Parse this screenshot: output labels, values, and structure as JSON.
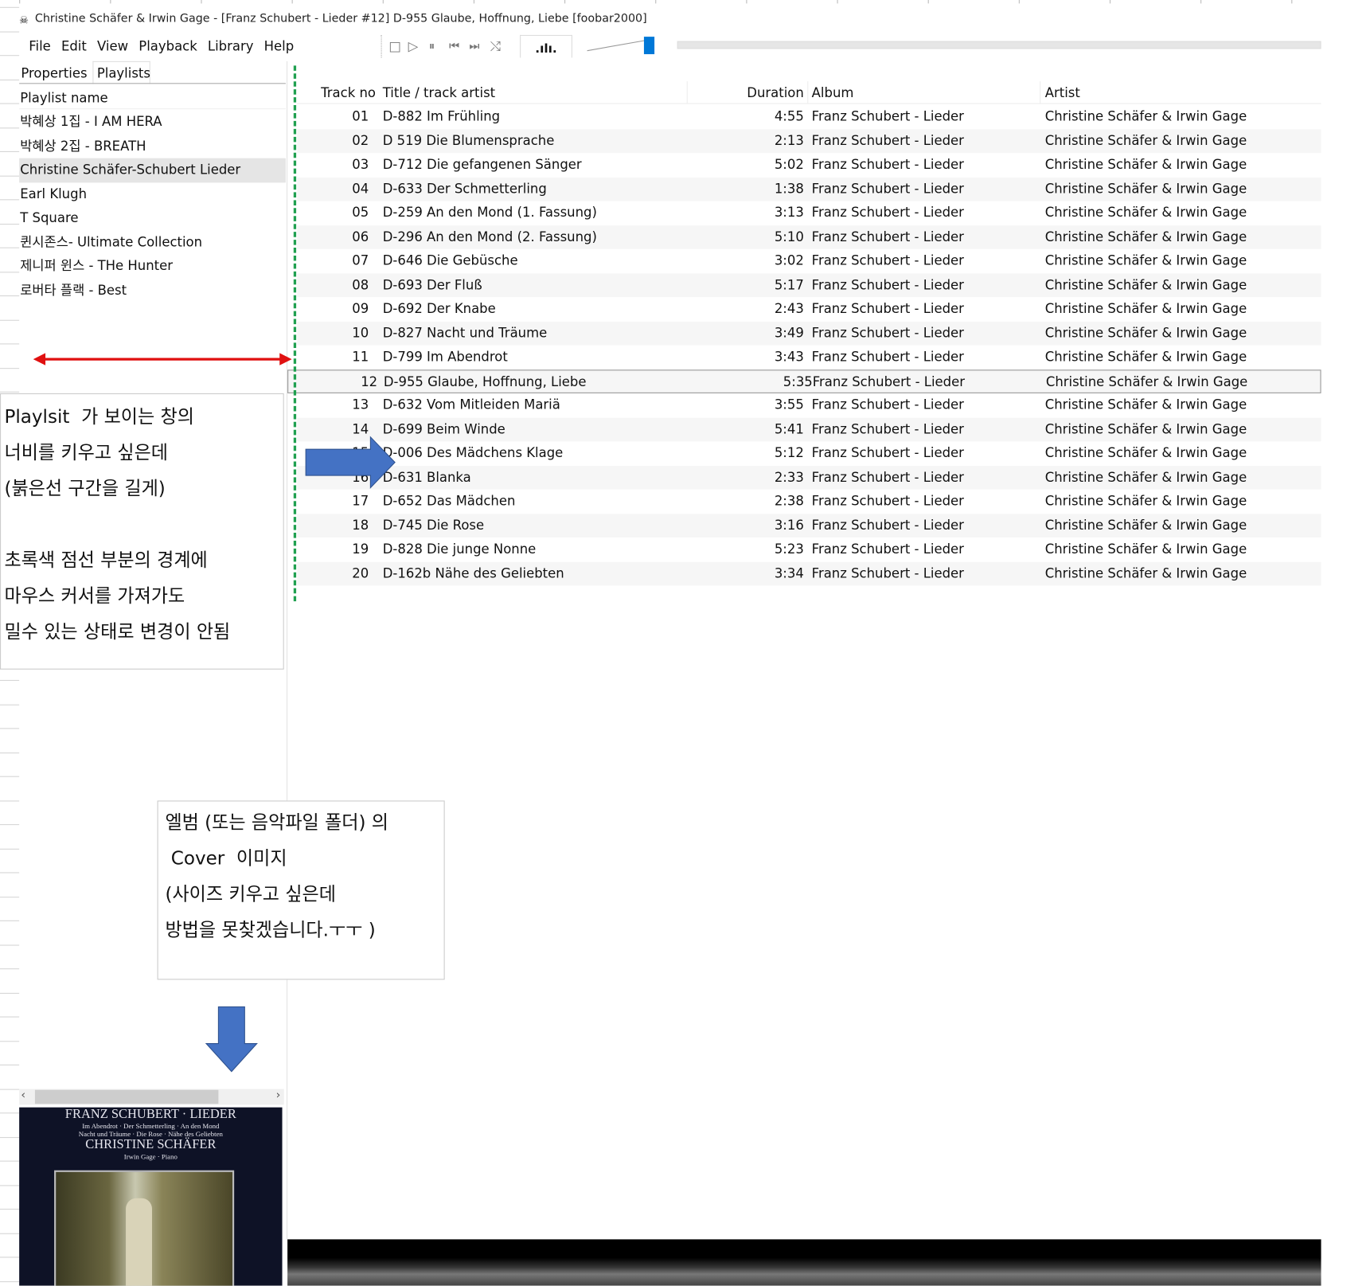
{
  "window": {
    "title": "Christine Schäfer & Irwin Gage - [Franz Schubert - Lieder #12] D-955 Glaube, Hoffnung, Liebe  [foobar2000]"
  },
  "menu": [
    "File",
    "Edit",
    "View",
    "Playback",
    "Library",
    "Help"
  ],
  "toolbar": {
    "stop": "□",
    "play": "▷",
    "pause": "⏸",
    "prev": "⏮",
    "next": "⏭",
    "random": "⤭",
    "visualizer": ".ılı.",
    "volume_percent": 95,
    "seek_percent": 0
  },
  "left_panel": {
    "tabs": [
      "Properties",
      "Playlists"
    ],
    "active_tab": "Playlists",
    "header": "Playlist name",
    "playlists": [
      "박혜상 1집 -  I AM HERA",
      "박혜상 2집 -  BREATH",
      "Christine Schäfer-Schubert Lieder",
      "Earl Klugh",
      "T Square",
      "퀸시존스-  Ultimate Collection",
      "제니퍼 윈스 -  THe Hunter",
      "로버타 플랙 - Best"
    ],
    "selected_index": 2
  },
  "columns": {
    "track": "Track no",
    "title": "Title / track artist",
    "duration": "Duration",
    "album": "Album",
    "artist": "Artist"
  },
  "tracks": [
    {
      "no": "01",
      "title": "D-882 Im Frühling",
      "dur": "4:55"
    },
    {
      "no": "02",
      "title": "D 519 Die Blumensprache",
      "dur": "2:13"
    },
    {
      "no": "03",
      "title": "D-712 Die gefangenen Sänger",
      "dur": "5:02"
    },
    {
      "no": "04",
      "title": "D-633 Der Schmetterling",
      "dur": "1:38"
    },
    {
      "no": "05",
      "title": "D-259 An den Mond (1. Fassung)",
      "dur": "3:13"
    },
    {
      "no": "06",
      "title": "D-296 An den Mond (2. Fassung)",
      "dur": "5:10"
    },
    {
      "no": "07",
      "title": "D-646 Die Gebüsche",
      "dur": "3:02"
    },
    {
      "no": "08",
      "title": "D-693 Der Fluß",
      "dur": "5:17"
    },
    {
      "no": "09",
      "title": "D-692 Der Knabe",
      "dur": "2:43"
    },
    {
      "no": "10",
      "title": "D-827 Nacht und Träume",
      "dur": "3:49"
    },
    {
      "no": "11",
      "title": "D-799 Im Abendrot",
      "dur": "3:43"
    },
    {
      "no": "12",
      "title": "D-955 Glaube, Hoffnung, Liebe",
      "dur": "5:35"
    },
    {
      "no": "13",
      "title": "D-632 Vom Mitleiden Mariä",
      "dur": "3:55"
    },
    {
      "no": "14",
      "title": "D-699 Beim Winde",
      "dur": "5:41"
    },
    {
      "no": "15",
      "title": "D-006 Des Mädchens Klage",
      "dur": "5:12"
    },
    {
      "no": "16",
      "title": "D-631 Blanka",
      "dur": "2:33"
    },
    {
      "no": "17",
      "title": "D-652 Das Mädchen",
      "dur": "2:38"
    },
    {
      "no": "18",
      "title": "D-745 Die Rose",
      "dur": "3:16"
    },
    {
      "no": "19",
      "title": "D-828 Die junge Nonne",
      "dur": "5:23"
    },
    {
      "no": "20",
      "title": "D-162b Nähe des Geliebten",
      "dur": "3:34"
    }
  ],
  "album": "Franz Schubert - Lieder",
  "artist": "Christine Schäfer & Irwin Gage",
  "focused_index": 11,
  "annotations": {
    "width_note": "Playlsit  가 보이는 창의\n너비를 키우고 싶은데\n(붉은선 구간을 길게)\n\n초록색 점선 부분의 경계에\n마우스 커서를 가져가도\n밀수 있는 상태로 변경이 안됨",
    "cover_note": "엘범 (또는 음악파일 폴더) 의\n Cover  이미지\n(사이즈 키우고 싶은데\n방법을 못찾겠습니다.ㅜㅜ )"
  },
  "cover": {
    "title": "FRANZ SCHUBERT · LIEDER",
    "line1": "Im Abendrot · Der Schmetterling · An den Mond",
    "line2": "Nacht und Träume · Die Rose · Nähe des Geliebten",
    "artist": "CHRISTINE SCHÄFER",
    "sub": "Irwin Gage · Piano"
  },
  "colors": {
    "accent": "#0078d7",
    "annotation_red": "#e01010",
    "annotation_green": "#20a050",
    "arrow_blue": "#4472c4"
  }
}
